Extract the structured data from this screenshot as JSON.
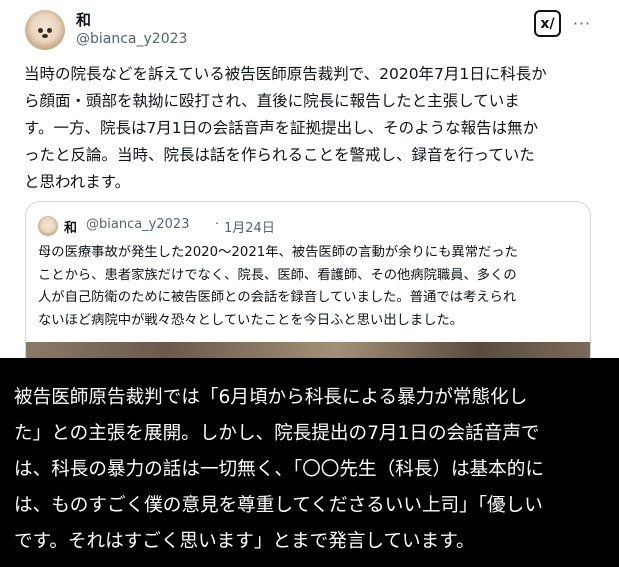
{
  "post": {
    "author_name": "和",
    "author_handle": "@bianca_y2023",
    "grok_label": "x/",
    "more_label": "···",
    "body": "当時の院長などを訴えている被告医師原告裁判で、2020年7月1日に科長か\nら顔面・頭部を執拗に殴打され、直後に院長に報告したと主張していま\nす。一方、院長は7月1日の会話音声を証拠提出し、そのような報告は無か\nったと反論。当時、院長は話を作られることを警戒し、録音を行っていた\nと思われます。"
  },
  "quote": {
    "author_name": "和",
    "author_handle": "@bianca_y2023",
    "separator": "·",
    "date": "1月24日",
    "body": "母の医療事故が発生した2020〜2021年、被告医師の言動が余りにも異常だった\nことから、患者家族だけでなく、院長、医師、看護師、その他病院職員、多くの\n人が自己防衛のために被告医師との会話を録音していました。普通では考えられ\nないほど病院中が戦々恐々としていたことを今日ふと思い出しました。"
  },
  "subtitle": {
    "text": "被告医師原告裁判では「6月頃から科長による暴力が常態化し\nた」との主張を展開。しかし、院長提出の7月1日の会話音声で\nは、科長の暴力の話は一切無く、「〇〇先生（科長）は基本的に\nは、ものすごく僕の意見を尊重してくださるいい上司」「優しい\nです。それはすごく思います」とまで発言しています。"
  }
}
